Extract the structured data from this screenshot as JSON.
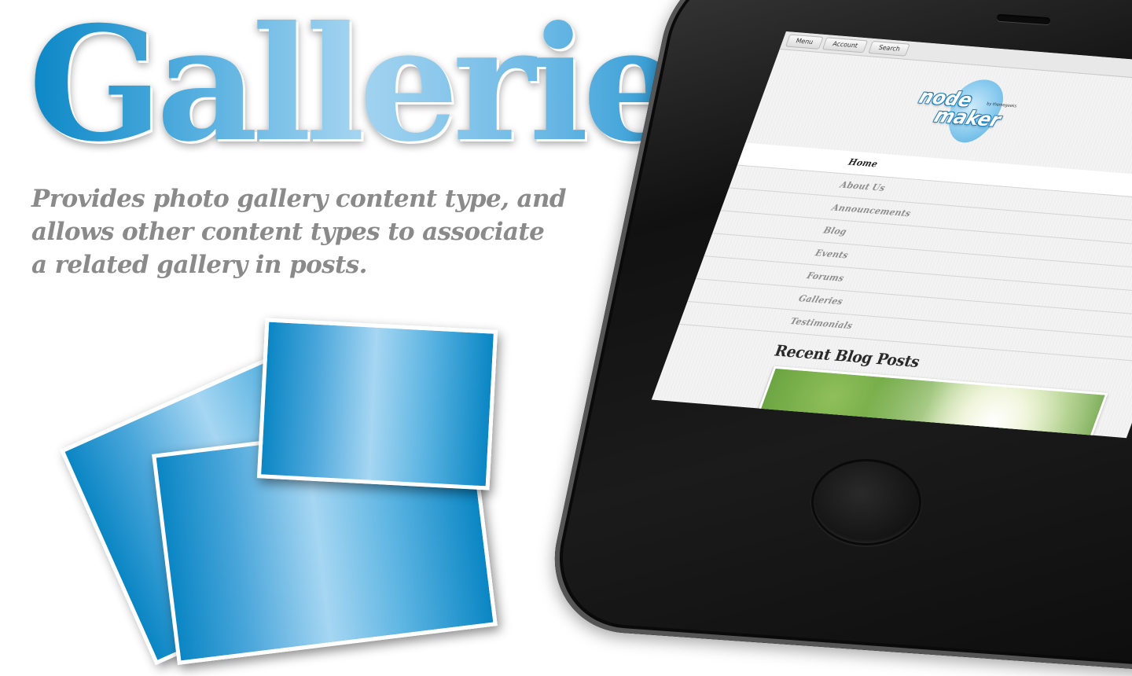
{
  "headline": "Galleries",
  "tagline": "Provides photo gallery content type, and allows other content types to associate a related gallery in posts.",
  "colors": {
    "brand_blue": "#0a87c6",
    "light_blue": "#a4d4f0",
    "tagline_gray": "#8a8a8a",
    "phone_black": "#111111"
  },
  "phone": {
    "screen": {
      "topbar": {
        "tabs": [
          "Menu",
          "Account",
          "Search"
        ]
      },
      "logo": {
        "line_1": "node",
        "line_2": "maker",
        "byline": "by themegeeks"
      },
      "nav": {
        "items": [
          {
            "label": "Home",
            "active": true,
            "has_submenu": false
          },
          {
            "label": "About Us",
            "active": false,
            "has_submenu": false
          },
          {
            "label": "Announcements",
            "active": false,
            "has_submenu": false
          },
          {
            "label": "Blog",
            "active": false,
            "has_submenu": true
          },
          {
            "label": "Events",
            "active": false,
            "has_submenu": true
          },
          {
            "label": "Forums",
            "active": false,
            "has_submenu": true
          },
          {
            "label": "Galleries",
            "active": false,
            "has_submenu": true
          },
          {
            "label": "Testimonials",
            "active": false,
            "has_submenu": false
          }
        ]
      },
      "section_title": "Recent Blog Posts"
    }
  }
}
